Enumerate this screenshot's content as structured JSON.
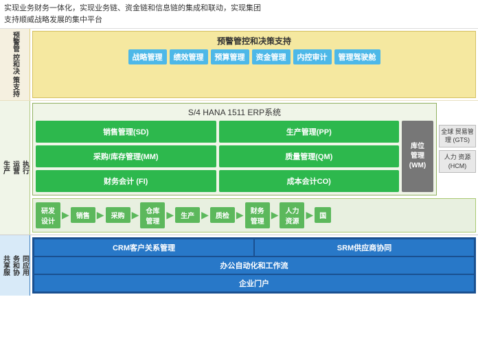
{
  "topText": {
    "line1": "实现业务财务一体化，实现业务链、资金链和信息链的集成和联动，实现集团",
    "line2": "支持顺威战略发展的集中平台"
  },
  "sections": {
    "warning": {
      "leftLabel": "预警管\n控和决\n策支持",
      "title": "预警管控和决策支持",
      "modules": [
        "战略管理",
        "绩效管理",
        "预算管理",
        "资金管理",
        "内控审计",
        "管理驾驶舱"
      ]
    },
    "production": {
      "leftLabel": "生产\n运营\n执行",
      "erp": {
        "title": "S/4 HANA 1511 ERP系统",
        "modules": [
          "销售管理(SD)",
          "生产管理(PP)",
          "采购/库存管理(MM)",
          "质量管理(QM)",
          "财务会计 (FI)",
          "成本会计CO)"
        ],
        "sideModule": {
          "label": "库位\n管理\n(WM)"
        }
      },
      "rightModules": [
        {
          "label": "全球\n贸易管\n理\n(GTS)"
        },
        {
          "label": "人力\n资源\n(HCM)"
        }
      ],
      "processFlow": [
        "研发\n设计",
        "销售",
        "采购",
        "仓库\n管理",
        "生产",
        "质检",
        "财务\n管理",
        "人力\n资源",
        "国"
      ]
    },
    "shared": {
      "leftLabel": "共享服\n务和协\n同应用",
      "rows": [
        {
          "cells": [
            {
              "text": "CRM客户关系管理",
              "flex": 1
            },
            {
              "text": "SRM供应商协同",
              "flex": 1
            }
          ]
        },
        {
          "cells": [
            {
              "text": "办公自动化和工作流",
              "flex": 2
            }
          ]
        },
        {
          "cells": [
            {
              "text": "企业门户",
              "flex": 2
            }
          ]
        }
      ]
    }
  }
}
